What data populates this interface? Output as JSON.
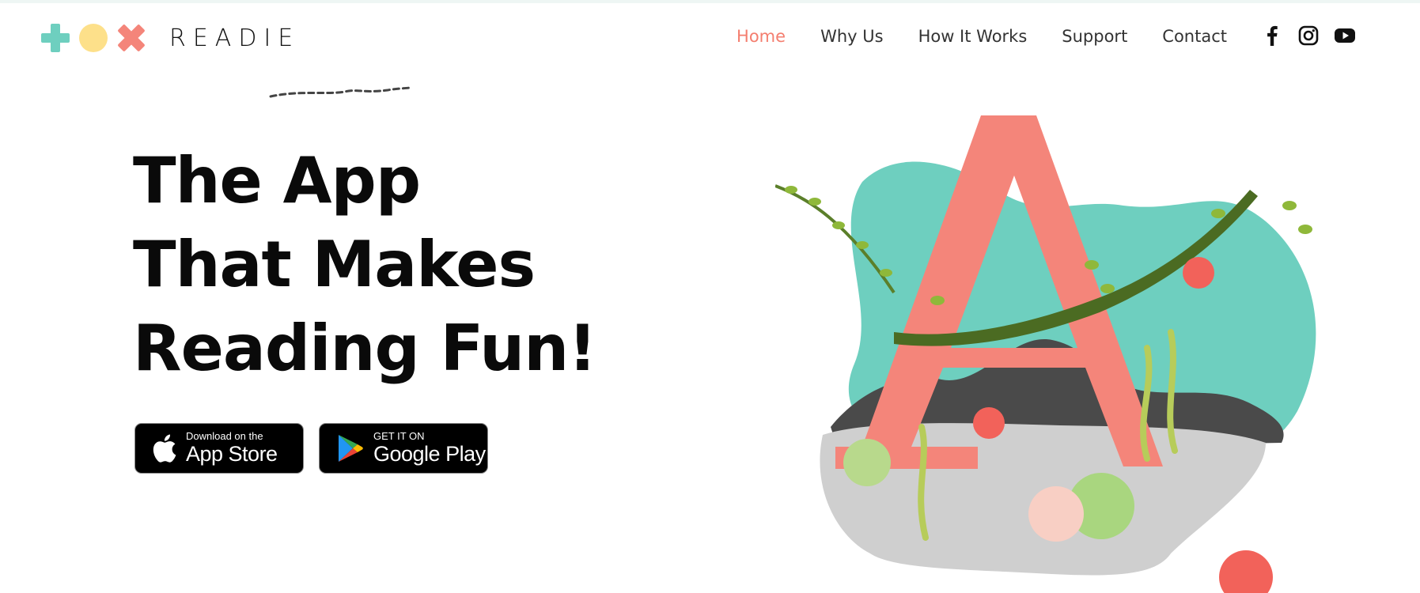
{
  "header": {
    "logo_text": "READIE",
    "logo_shapes": [
      "plus-icon",
      "circle-icon",
      "cross-icon"
    ]
  },
  "nav": {
    "items": [
      {
        "label": "Home",
        "active": true
      },
      {
        "label": "Why Us",
        "active": false
      },
      {
        "label": "How It Works",
        "active": false
      },
      {
        "label": "Support",
        "active": false
      },
      {
        "label": "Contact",
        "active": false
      }
    ],
    "social": [
      "facebook-icon",
      "instagram-icon",
      "youtube-icon"
    ]
  },
  "hero": {
    "title_lines": [
      "The App",
      "That Makes",
      "Reading Fun!"
    ],
    "app_store": {
      "small": "Download on the",
      "large": "App Store"
    },
    "google_play": {
      "small": "GET IT ON",
      "large": "Google Play"
    }
  },
  "colors": {
    "accent": "#f47e6f",
    "mint": "#6ecfbf",
    "yellow": "#fde08a",
    "text": "#0a0a0a",
    "nav_text": "#333333",
    "branch": "#3d5a1e",
    "letter": "#f4857a"
  },
  "illustration": {
    "subject": "letter-a-with-apples-and-branch"
  }
}
